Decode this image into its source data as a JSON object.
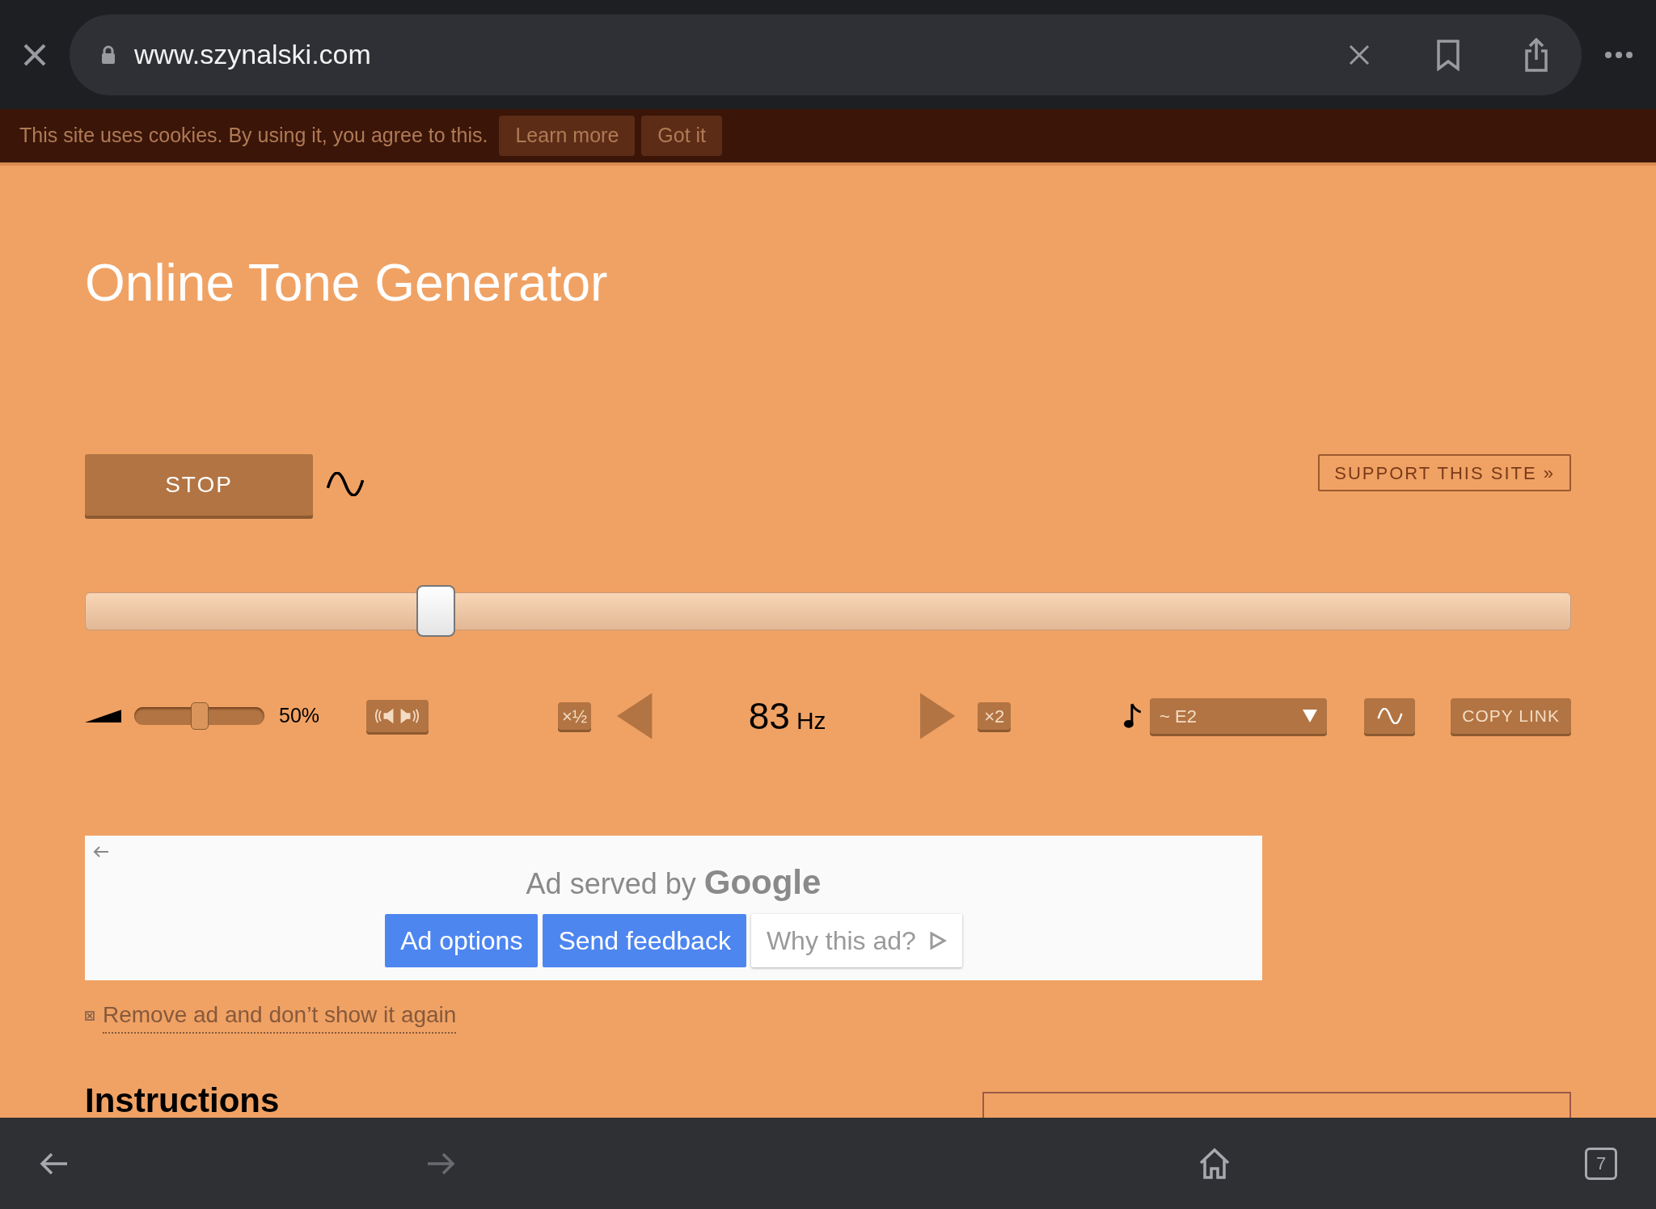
{
  "browser": {
    "url": "www.szynalski.com",
    "tab_count": "7",
    "back_disabled": false,
    "forward_disabled": true
  },
  "cookie_banner": {
    "text": "This site uses cookies. By using it, you agree to this.",
    "buttons": [
      "Learn more",
      "Got it"
    ]
  },
  "title": "Online Tone Generator",
  "play_button": "STOP",
  "support_link": "SUPPORT THIS SITE »",
  "frequency_slider": {
    "level": 0.236
  },
  "volume": {
    "level": 0.5,
    "reading": "50%"
  },
  "half_button": "×½",
  "double_button": "×2",
  "frequency": {
    "value": "83",
    "unit": "Hz"
  },
  "note_select": {
    "value": "~ E2"
  },
  "copy_link": "COPY LINK",
  "ad": {
    "heading": "Ad served by",
    "brand": "Google",
    "buttons": [
      {
        "label": "Ad options",
        "kind": "primary"
      },
      {
        "label": "Send feedback",
        "kind": "primary"
      },
      {
        "label": "Why this ad?",
        "kind": "secondary"
      }
    ]
  },
  "remove_ad_link": "Remove ad and don’t show it again",
  "instructions_heading": "Instructions"
}
